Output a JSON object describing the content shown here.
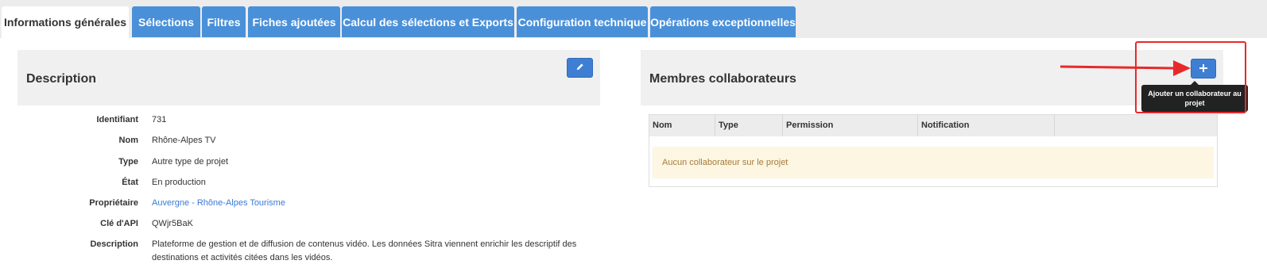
{
  "tabs": [
    {
      "label": "Informations générales",
      "active": true
    },
    {
      "label": "Sélections"
    },
    {
      "label": "Filtres"
    },
    {
      "label": "Fiches ajoutées"
    },
    {
      "label": "Calcul des sélections et Exports"
    },
    {
      "label": "Configuration technique"
    },
    {
      "label": "Opérations exceptionnelles"
    }
  ],
  "description_panel": {
    "title": "Description",
    "edit_icon": "pencil-icon",
    "fields": [
      {
        "label": "Identifiant",
        "value": "731"
      },
      {
        "label": "Nom",
        "value": "Rhône-Alpes TV"
      },
      {
        "label": "Type",
        "value": "Autre type de projet"
      },
      {
        "label": "État",
        "value": "En production"
      },
      {
        "label": "Propriétaire",
        "value": "Auvergne - Rhône-Alpes Tourisme",
        "link": true
      },
      {
        "label": "Clé d'API",
        "value": "QWjr5BaK"
      },
      {
        "label": "Description",
        "value_line1": "Plateforme de gestion et de diffusion de contenus vidéo. Les données Sitra viennent enrichir les descriptif des",
        "value_line2": "destinations et activités citées dans les vidéos."
      }
    ]
  },
  "members_panel": {
    "title": "Membres collaborateurs",
    "add_icon": "plus-icon",
    "add_tooltip_line1": "Ajouter un collaborateur au",
    "add_tooltip_line2": "projet",
    "columns": [
      "Nom",
      "Type",
      "Permission",
      "Notification"
    ],
    "empty_message": "Aucun collaborateur sur le projet"
  },
  "colors": {
    "tab_blue": "#4a90d9",
    "button_blue": "#3f7fd3",
    "annotation_red": "#e8292b"
  }
}
